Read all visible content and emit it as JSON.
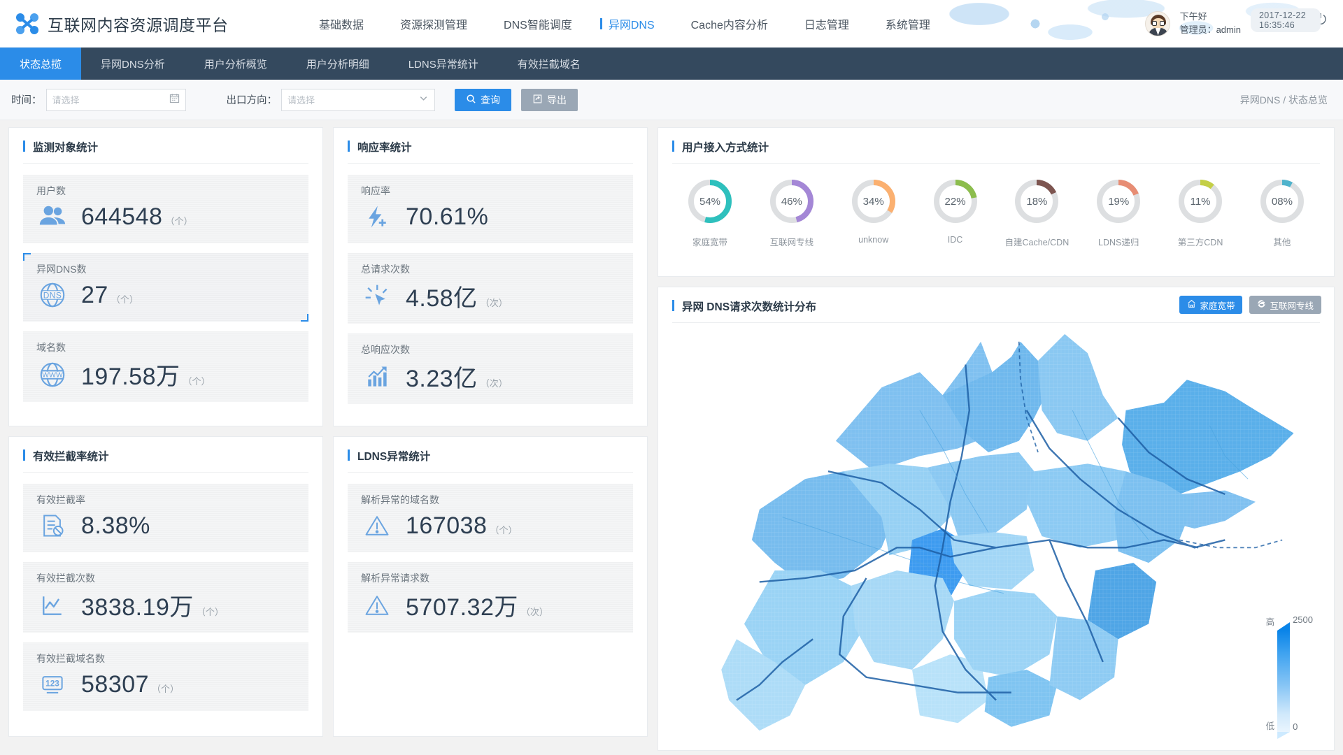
{
  "header": {
    "logo_icon": "network-nodes-logo",
    "title": "互联网内容资源调度平台",
    "nav": [
      {
        "label": "基础数据",
        "active": false
      },
      {
        "label": "资源探测管理",
        "active": false
      },
      {
        "label": "DNS智能调度",
        "active": false
      },
      {
        "label": "异网DNS",
        "active": true
      },
      {
        "label": "Cache内容分析",
        "active": false
      },
      {
        "label": "日志管理",
        "active": false
      },
      {
        "label": "系统管理",
        "active": false
      }
    ],
    "user": {
      "greeting": "下午好",
      "role_line": "管理员：admin",
      "datetime": "2017-12-22  16:35:46",
      "icons": [
        "clock-icon",
        "list-icon",
        "power-icon"
      ]
    }
  },
  "tabs": [
    {
      "label": "状态总揽",
      "active": true
    },
    {
      "label": "异网DNS分析",
      "active": false
    },
    {
      "label": "用户分析概览",
      "active": false
    },
    {
      "label": "用户分析明细",
      "active": false
    },
    {
      "label": "LDNS异常统计",
      "active": false
    },
    {
      "label": "有效拦截域名",
      "active": false
    }
  ],
  "filter": {
    "time_label": "时间：",
    "time_placeholder": "请选择",
    "time_value": "",
    "time_icon": "calendar-icon",
    "direction_label": "出口方向：",
    "direction_placeholder": "请选择",
    "direction_value": "",
    "direction_icon": "chevron-down-icon",
    "query_button": "查询",
    "query_icon": "search-icon",
    "export_button": "导出",
    "export_icon": "export-icon",
    "breadcrumb": "异网DNS / 状态总览"
  },
  "cards": {
    "monitor": {
      "title": "监测对象统计",
      "stats": [
        {
          "label": "用户数",
          "value": "644548",
          "unit": "（个）",
          "icon": "users-icon",
          "selected": false
        },
        {
          "label": "异网DNS数",
          "value": "27",
          "unit": "（个）",
          "icon": "dns-globe-icon",
          "selected": true
        },
        {
          "label": "域名数",
          "value": "197.58万",
          "unit": "（个）",
          "icon": "www-globe-icon",
          "selected": false
        }
      ]
    },
    "response": {
      "title": "响应率统计",
      "stats": [
        {
          "label": "响应率",
          "value": "70.61%",
          "unit": "",
          "icon": "lightning-plus-icon",
          "selected": false
        },
        {
          "label": "总请求次数",
          "value": "4.58亿",
          "unit": "（次）",
          "icon": "click-cursor-icon",
          "selected": false
        },
        {
          "label": "总响应次数",
          "value": "3.23亿",
          "unit": "（次）",
          "icon": "bar-chart-up-icon",
          "selected": false
        }
      ]
    },
    "intercept": {
      "title": "有效拦截率统计",
      "stats": [
        {
          "label": "有效拦截率",
          "value": "8.38%",
          "unit": "",
          "icon": "doc-block-icon",
          "selected": false
        },
        {
          "label": "有效拦截次数",
          "value": "3838.19万",
          "unit": "（个）",
          "icon": "line-chart-icon",
          "selected": false
        },
        {
          "label": "有效拦截域名数",
          "value": "58307",
          "unit": "（个）",
          "icon": "number-123-icon",
          "selected": false
        }
      ]
    },
    "ldns": {
      "title": "LDNS异常统计",
      "stats": [
        {
          "label": "解析异常的域名数",
          "value": "167038",
          "unit": "（个）",
          "icon": "warning-triangle-icon",
          "selected": false
        },
        {
          "label": "解析异常请求数",
          "value": "5707.32万",
          "unit": "（次）",
          "icon": "warning-triangle-icon",
          "selected": false
        }
      ]
    }
  },
  "access": {
    "title": "用户接入方式统计"
  },
  "map": {
    "title": "异网 DNS请求次数统计分布",
    "buttons": [
      {
        "label": "家庭宽带",
        "icon": "home-icon",
        "active": true
      },
      {
        "label": "互联网专线",
        "icon": "ie-browser-icon",
        "active": false
      }
    ],
    "legend": {
      "high_label": "高",
      "low_label": "低",
      "max": "2500",
      "min": "0"
    }
  },
  "chart_data": {
    "type": "pie",
    "title": "用户接入方式统计",
    "legend_position": "below-each",
    "items": [
      {
        "label": "家庭宽带",
        "display": "54%",
        "value": 54,
        "color": "#2ec0bd"
      },
      {
        "label": "互联网专线",
        "display": "46%",
        "value": 46,
        "color": "#a487d6"
      },
      {
        "label": "unknow",
        "display": "34%",
        "value": 34,
        "color": "#fbb070"
      },
      {
        "label": "IDC",
        "display": "22%",
        "value": 22,
        "color": "#8cbd4d"
      },
      {
        "label": "自建Cache/CDN",
        "display": "18%",
        "value": 18,
        "color": "#7d5550"
      },
      {
        "label": "LDNS递归",
        "display": "19%",
        "value": 19,
        "color": "#e78d74"
      },
      {
        "label": "第三方CDN",
        "display": "11%",
        "value": 11,
        "color": "#c4cf46"
      },
      {
        "label": "其他",
        "display": "08%",
        "value": 8,
        "color": "#4fb3cc"
      }
    ],
    "track_color": "#dddfe1"
  }
}
